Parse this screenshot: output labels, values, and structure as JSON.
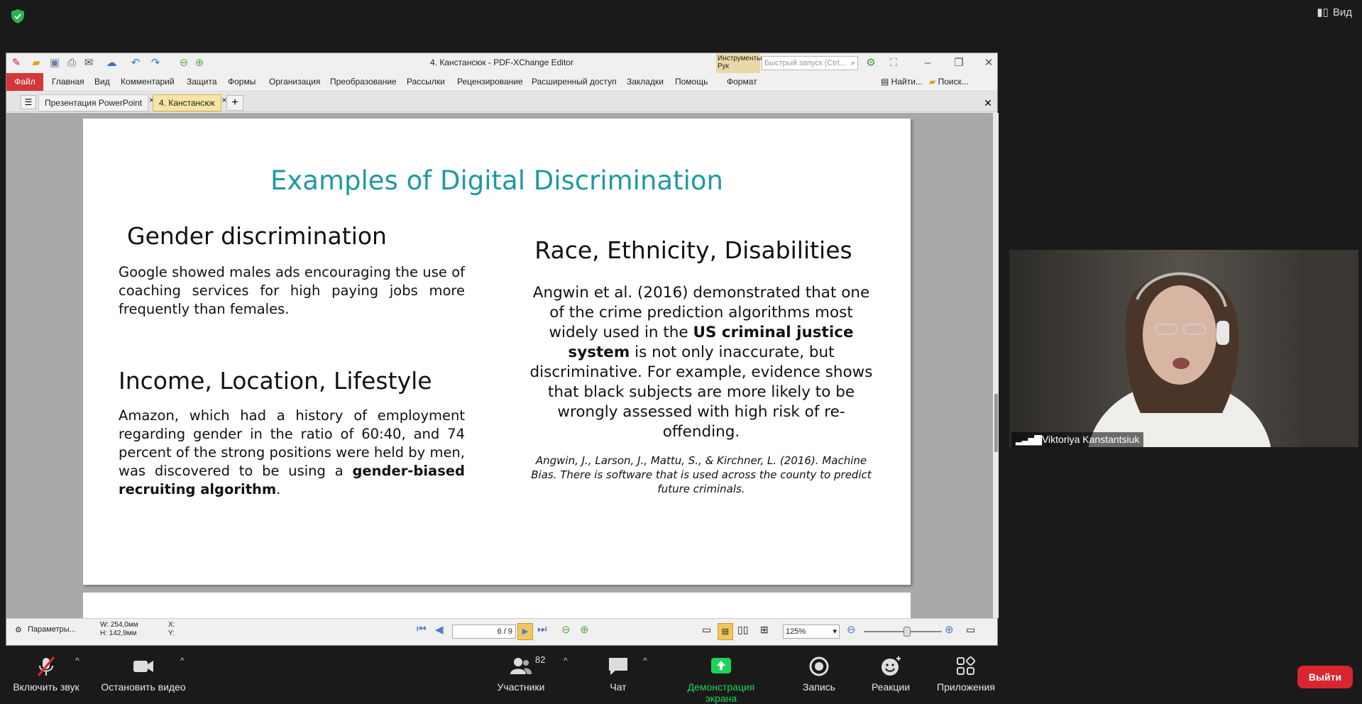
{
  "top": {
    "view_label": "Вид"
  },
  "window": {
    "title": "4. Канстансюк - PDF-XChange Editor"
  },
  "toolbar": {
    "tools_label": "Инструменты Рук",
    "search_placeholder": "Быстрый запуск (Ctrl..."
  },
  "menu": {
    "file": "Файл",
    "items": [
      "Главная",
      "Вид",
      "Комментарий",
      "Защита",
      "Формы",
      "Организация",
      "Преобразование",
      "Рассылки",
      "Рецензирование",
      "Расширенный доступ",
      "Закладки",
      "Помощь"
    ],
    "format": "Формат",
    "find": "Найти...",
    "search": "Поиск..."
  },
  "tabs": [
    {
      "label": "Презентация PowerPoint",
      "active": false
    },
    {
      "label": "4. Канстансюк",
      "active": true
    }
  ],
  "slide": {
    "title": "Examples of Digital Discrimination",
    "gender": {
      "heading": "Gender discrimination",
      "text": "Google showed males ads encouraging the use of coaching services for high paying jobs more frequently than females."
    },
    "income": {
      "heading": "Income, Location, Lifestyle",
      "text_a": "Amazon, which had a history of employment regarding gender in the ratio of 60:40, and 74 percent of the strong positions were held by men, was discovered to be using a ",
      "text_bold": "gender-biased recruiting algorithm",
      "text_b": "."
    },
    "race": {
      "heading": "Race, Ethnicity, Disabilities",
      "text_a": "Angwin et al. (2016) demonstrated that one of the crime prediction algorithms most widely used in the ",
      "text_bold": "US criminal justice system",
      "text_b": " is not only inaccurate, but discriminative. For example, evidence shows that black subjects are more likely to be wrongly assessed with high risk of re-offending."
    },
    "citation": "Angwin, J., Larson, J., Mattu, S., & Kirchner, L. (2016). Machine Bias. There is software that is used across the county to predict future criminals."
  },
  "status": {
    "params": "Параметры...",
    "width": "W: 254,0мм",
    "height": "H: 142,9мм",
    "x": "X:",
    "y": "Y:",
    "page": "6 / 9",
    "zoom": "125%",
    "zoom_level": 0.55
  },
  "participant": {
    "name": "Viktoriya Kanstantsiuk"
  },
  "controls": {
    "unmute": "Включить звук",
    "stop_video": "Остановить видео",
    "participants": "Участники",
    "participants_count": "82",
    "chat": "Чат",
    "share": "Демонстрация экрана",
    "record": "Запись",
    "reactions": "Реакции",
    "apps": "Приложения",
    "leave": "Выйти"
  },
  "colors": {
    "slide_title": "#1e9aa3",
    "share_green": "#1fd35a",
    "leave_red": "#d9252f",
    "file_menu": "#d2383a",
    "active_tab": "#f6e5a4"
  }
}
